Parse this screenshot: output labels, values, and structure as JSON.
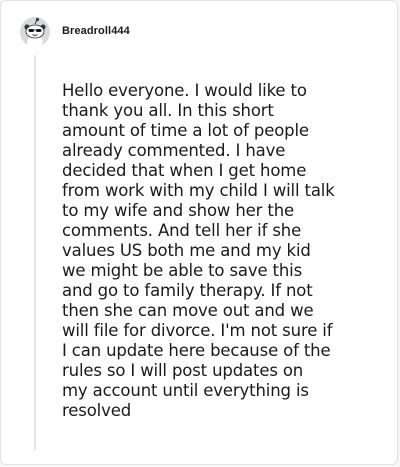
{
  "comment": {
    "author": "Breadroll444",
    "avatar_icon": "snoo-avatar-icon",
    "body": "Hello everyone. I would like to\nthank you all. In this short\namount of time a lot of people\nalready commented. I have\ndecided that when I get home\nfrom work with my child I will talk\nto my wife and show her the\ncomments. And tell her if she\nvalues US both me and my kid\nwe might be able to save this\nand go to family therapy. If not\nthen she can move out and we\nwill file for divorce. I'm not sure if\nI can update here because of the\nrules so I will post updates on\nmy account until everything is\nresolved"
  },
  "colors": {
    "text": "#1a1a1b",
    "thread_line": "#e4e4e6",
    "card_border": "#e3e3e6"
  }
}
